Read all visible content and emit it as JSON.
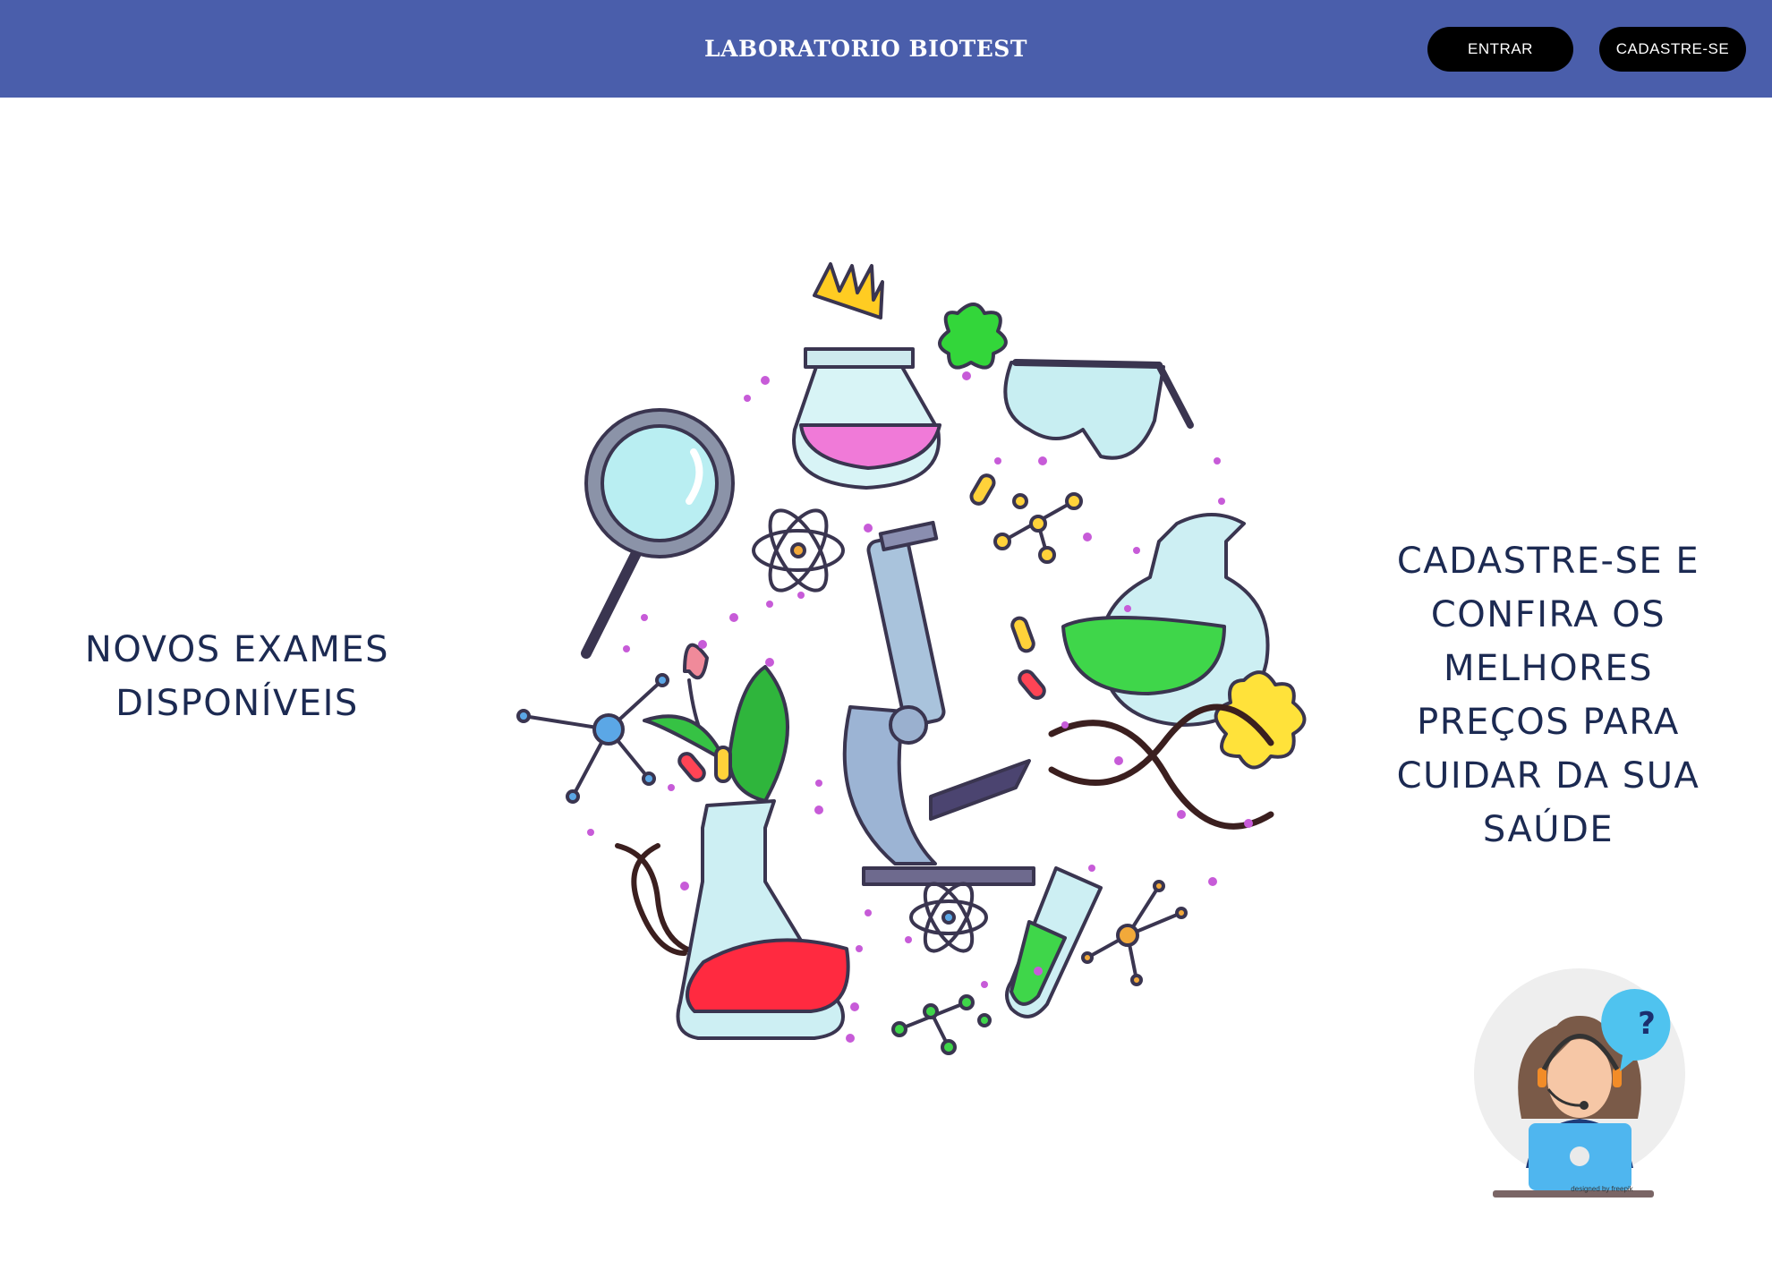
{
  "header": {
    "title": "LABORATORIO BIOTEST",
    "login_label": "ENTRAR",
    "signup_label": "CADASTRE-SE"
  },
  "main": {
    "left_text_line1": "NOVOS EXAMES",
    "left_text_line2": "DISPONÍVEIS",
    "right_text_lines": [
      "CADASTRE-SE E",
      "CONFIRA OS",
      "MELHORES",
      "PREÇOS PARA",
      "CUIDAR DA SUA",
      "SAÚDE"
    ]
  },
  "support_widget": {
    "icon": "customer-support-icon",
    "question_mark": "?",
    "credit": "designed by freepik"
  },
  "colors": {
    "header_bg": "#4a5eab",
    "button_bg": "#000000",
    "text_dark": "#1c2a52"
  }
}
